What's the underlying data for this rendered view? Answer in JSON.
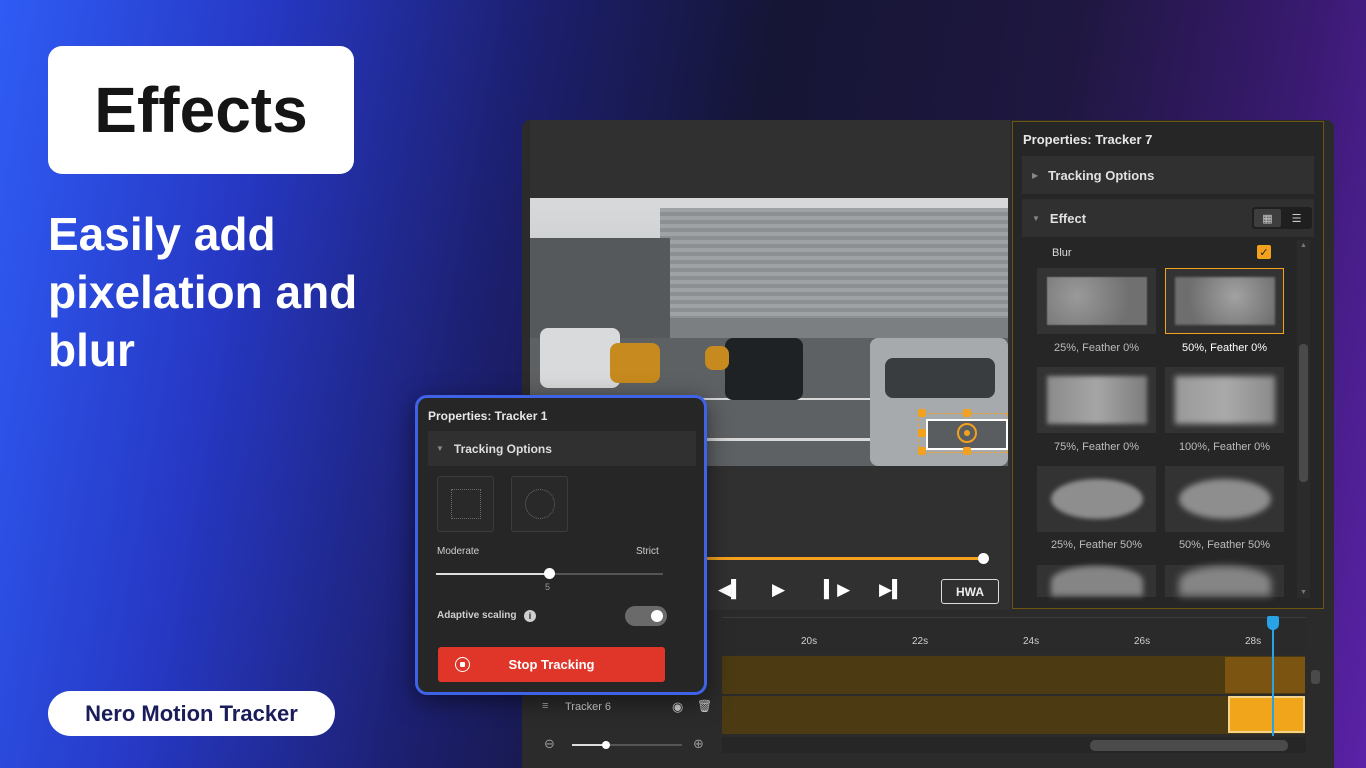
{
  "hero": {
    "badge": "Effects",
    "headline": "Easily add pixelation and blur",
    "product_name": "Nero Motion Tracker"
  },
  "props7": {
    "title": "Properties: Tracker 7",
    "tracking_options": "Tracking Options",
    "effect": "Effect",
    "blur_label": "Blur",
    "blur_checked": true,
    "thumbnails": [
      {
        "caption": "25%, Feather 0%",
        "selected": false
      },
      {
        "caption": "50%, Feather 0%",
        "selected": true
      },
      {
        "caption": "75%, Feather 0%",
        "selected": false
      },
      {
        "caption": "100%, Feather 0%",
        "selected": false
      },
      {
        "caption": "25%, Feather 50%",
        "selected": false
      },
      {
        "caption": "50%, Feather 50%",
        "selected": false
      }
    ]
  },
  "player": {
    "hwa_label": "HWA"
  },
  "timeline": {
    "ticks": [
      "20s",
      "22s",
      "24s",
      "26s",
      "28s"
    ],
    "track_name": "Tracker 6"
  },
  "props1": {
    "title": "Properties: Tracker 1",
    "tracking_options": "Tracking Options",
    "slider_min_label": "Moderate",
    "slider_max_label": "Strict",
    "slider_value": "5",
    "adaptive_label": "Adaptive scaling",
    "adaptive_on": true,
    "stop_button": "Stop Tracking"
  },
  "colors": {
    "accent": "#f4a11d",
    "stop": "#e0362a",
    "highlight": "#3f63e6",
    "playhead": "#27a3e6"
  }
}
